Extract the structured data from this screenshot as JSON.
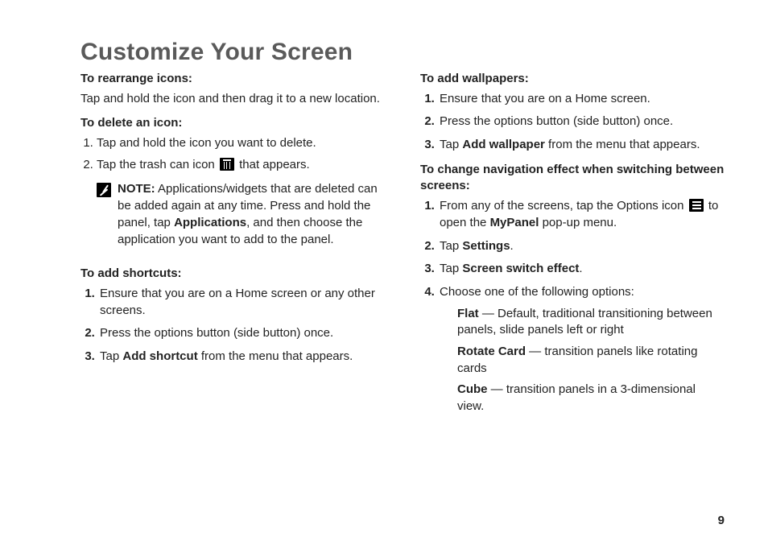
{
  "title": "Customize Your Screen",
  "pageNumber": "9",
  "left": {
    "rearrange": {
      "heading": "To rearrange icons:",
      "body": "Tap and hold the icon and then drag it to a new location."
    },
    "delete": {
      "heading": "To delete an icon:",
      "step1": "Tap and hold the icon you want to delete.",
      "step2a": "Tap the trash can icon",
      "step2b": "that appears."
    },
    "note": {
      "label": "NOTE:",
      "t1": " Applications/widgets that are deleted can be added again at any time. Press and hold the panel, tap ",
      "bold": "Applications",
      "t2": ", and then choose the application you want to add to the panel."
    },
    "shortcuts": {
      "heading": "To add shortcuts:",
      "s1": "Ensure that you are on a Home screen or any other screens.",
      "s2": "Press the options button (side button) once.",
      "s3a": "Tap ",
      "s3bold": "Add shortcut",
      "s3b": " from the menu that appears."
    }
  },
  "right": {
    "wallpapers": {
      "heading": "To add wallpapers:",
      "s1": "Ensure that you are on a Home screen.",
      "s2": "Press the options button (side button) once.",
      "s3a": "Tap ",
      "s3bold": "Add wallpaper",
      "s3b": " from the menu that appears."
    },
    "nav": {
      "heading": "To change navigation effect when switching between screens:",
      "s1a": "From any of the screens, tap the Options icon",
      "s1b": "to open the ",
      "s1bold": "MyPanel",
      "s1c": " pop-up menu.",
      "s2a": "Tap ",
      "s2b": "Settings",
      "s2c": ".",
      "s3a": "Tap ",
      "s3b": "Screen switch effect",
      "s3c": ".",
      "s4": "Choose one of the following options:",
      "optFlatB": "Flat",
      "optFlatT": " — Default, traditional transitioning between panels, slide panels left or right",
      "optRotB": "Rotate Card",
      "optRotT": " — transition panels like rotating cards",
      "optCubeB": "Cube",
      "optCubeT": " — transition panels in a 3-dimensional view."
    }
  }
}
